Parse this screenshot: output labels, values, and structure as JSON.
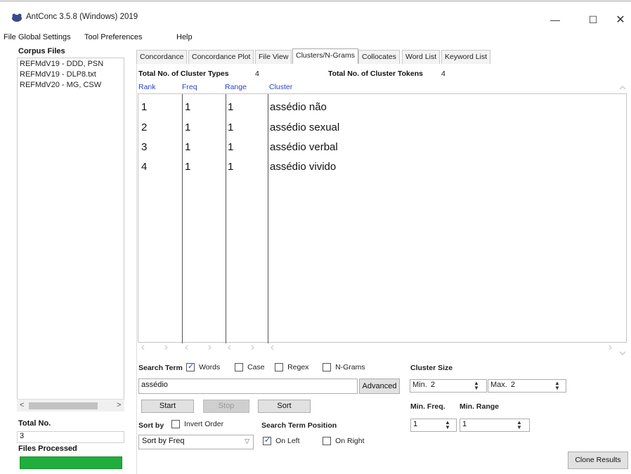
{
  "window": {
    "title": "AntConc 3.5.8 (Windows) 2019",
    "minimize_glyph": "—",
    "maximize_glyph": "☐",
    "close_glyph": "✕"
  },
  "menu": [
    "File",
    "Global Settings",
    "Tool Preferences",
    "Help"
  ],
  "sidebar": {
    "title": "Corpus Files",
    "files": [
      "REFMdV19 - DDD, PSN",
      "REFMdV19 - DLP8.txt",
      "REFMdV20 - MG, CSW"
    ],
    "total_label": "Total No.",
    "total_value": "3",
    "processed_label": "Files Processed",
    "progress": 1.0,
    "progress_color": "#1fae3b",
    "scroll_left": "<",
    "scroll_right": ">"
  },
  "tabs": [
    "Concordance",
    "Concordance Plot",
    "File View",
    "Clusters/N-Grams",
    "Collocates",
    "Word List",
    "Keyword List"
  ],
  "active_tab": "Clusters/N-Grams",
  "stats": {
    "types_label": "Total No. of Cluster Types",
    "types_value": "4",
    "tokens_label": "Total No. of Cluster Tokens",
    "tokens_value": "4"
  },
  "table": {
    "headers": [
      "Rank",
      "Freq",
      "Range",
      "Cluster"
    ],
    "header_color": "#2a42c8",
    "rows": [
      [
        "1",
        "1",
        "1",
        "assédio não"
      ],
      [
        "2",
        "1",
        "1",
        "assédio sexual"
      ],
      [
        "3",
        "1",
        "1",
        "assédio verbal"
      ],
      [
        "4",
        "1",
        "1",
        "assédio vivido"
      ]
    ]
  },
  "search": {
    "label": "Search Term",
    "options": [
      {
        "label": "Words",
        "checked": true
      },
      {
        "label": "Case",
        "checked": false
      },
      {
        "label": "Regex",
        "checked": false
      },
      {
        "label": "N-Grams",
        "checked": false
      }
    ],
    "value": "assédio",
    "advanced_label": "Advanced",
    "start_label": "Start",
    "stop_label": "Stop",
    "sort_label": "Sort"
  },
  "sort": {
    "label": "Sort by",
    "invert_label": "Invert Order",
    "invert_checked": false,
    "selected": "Sort by Freq"
  },
  "position": {
    "label": "Search Term Position",
    "on_left_label": "On Left",
    "on_left_checked": true,
    "on_right_label": "On Right",
    "on_right_checked": false
  },
  "cluster_size": {
    "label": "Cluster Size",
    "min_label": "Min.",
    "min_value": "2",
    "max_label": "Max.",
    "max_value": "2"
  },
  "min_freq": {
    "label": "Min. Freq.",
    "value": "1"
  },
  "min_range": {
    "label": "Min. Range",
    "value": "1"
  },
  "clone_label": "Clone Results"
}
